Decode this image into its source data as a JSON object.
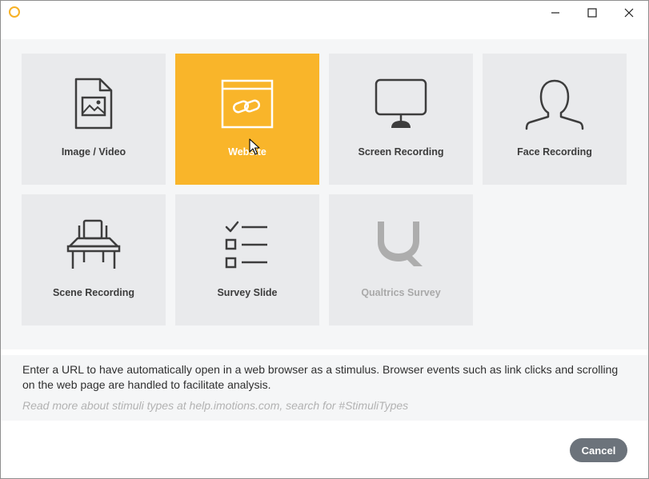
{
  "window": {
    "logo_icon": "imotions-ring-icon",
    "accent_color": "#f9b52a",
    "controls": [
      "minimize",
      "maximize",
      "close"
    ]
  },
  "tiles": [
    {
      "label": "Image / Video",
      "icon": "image-file-icon",
      "state": "normal"
    },
    {
      "label": "Website",
      "icon": "website-link-icon",
      "state": "selected"
    },
    {
      "label": "Screen Recording",
      "icon": "monitor-icon",
      "state": "normal"
    },
    {
      "label": "Face Recording",
      "icon": "person-bust-icon",
      "state": "normal"
    },
    {
      "label": "Scene Recording",
      "icon": "desk-icon",
      "state": "normal"
    },
    {
      "label": "Survey Slide",
      "icon": "checklist-icon",
      "state": "normal"
    },
    {
      "label": "Qualtrics Survey",
      "icon": "qualtrics-logo-icon",
      "state": "disabled"
    }
  ],
  "description": "Enter a URL to have automatically open in a web browser as a stimulus. Browser events such as link clicks and scrolling on the web page are handled to facilitate analysis.",
  "help_text": "Read more about stimuli types at help.imotions.com, search for #StimuliTypes",
  "buttons": {
    "cancel": "Cancel"
  }
}
